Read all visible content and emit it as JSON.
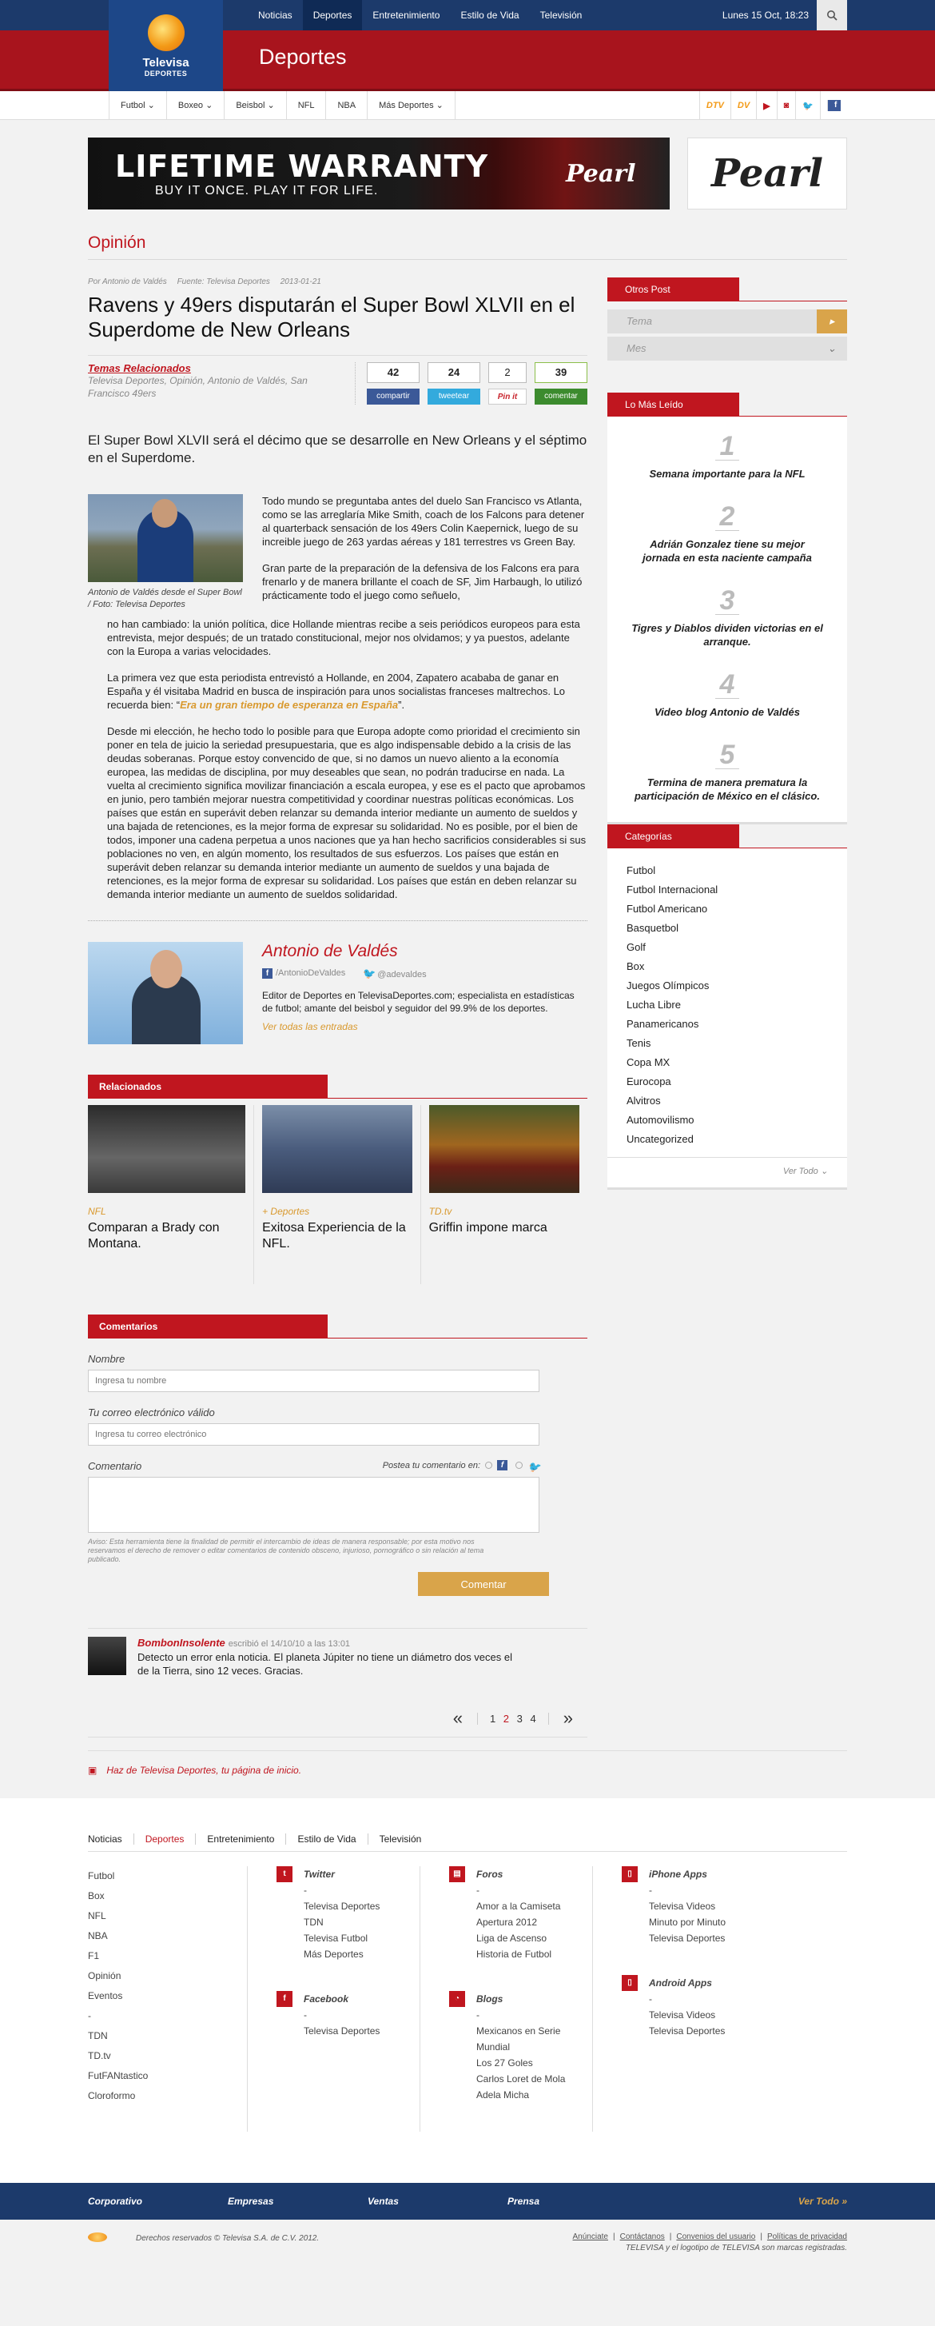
{
  "topnav": {
    "items": [
      "Noticias",
      "Deportes",
      "Entretenimiento",
      "Estilo de Vida",
      "Televisión"
    ],
    "active_index": 1,
    "date": "Lunes 15 Oct, 18:23"
  },
  "logo": {
    "line1": "Televisa",
    "line2": "DEPORTES"
  },
  "section_title": "Deportes",
  "subnav": {
    "items": [
      "Futbol",
      "Boxeo",
      "Beisbol",
      "NFL",
      "NBA",
      "Más Deportes"
    ],
    "icons": [
      "DTV",
      "DV"
    ]
  },
  "ad": {
    "headline": "LIFETIME WARRANTY",
    "tagline": "BUY IT ONCE.   PLAY IT FOR LIFE.",
    "brand": "Pearl",
    "side_brand": "Pearl"
  },
  "section_label": "Opinión",
  "article": {
    "meta": {
      "author": "Por Antonio de Valdés",
      "source": "Fuente: Televisa Deportes",
      "date": "2013-01-21"
    },
    "title": "Ravens y 49ers disputarán el Super Bowl XLVII en el Superdome de New Orleans",
    "related_topics_label": "Temas Relacionados",
    "related_topics": "Televisa Deportes, Opinión, Antonio de Valdés, San Francisco 49ers",
    "share": {
      "facebook": {
        "count": "42",
        "label": "compartir"
      },
      "twitter": {
        "count": "24",
        "label": "tweetear"
      },
      "pinterest": {
        "count": "2",
        "label": "Pin it"
      },
      "comment": {
        "count": "39",
        "label": "comentar"
      }
    },
    "lede": "El Super Bowl XLVII será el décimo que se desarrolle en New Orleans y el séptimo en el Superdome.",
    "figure_caption": "Antonio de Valdés desde el Super Bowl  / Foto: Televisa Deportes",
    "p1": "Todo mundo se preguntaba antes del duelo San Francisco vs Atlanta, como se las arreglaría Mike Smith, coach de los Falcons para detener al quarterback sensación de los 49ers Colin Kaepernick, luego de su increible juego de 263 yardas aéreas y 181 terrestres vs Green Bay.",
    "p2": "Gran parte de la preparación de la defensiva de los Falcons era para frenarlo y de manera brillante el coach de SF, Jim Harbaugh, lo utilizó prácticamente todo el juego como señuelo,",
    "p3": "no han cambiado: la unión política, dice Hollande mientras recibe a seis periódicos europeos para esta entrevista, mejor después; de un tratado constitucional, mejor nos olvidamos; y ya puestos, adelante con la Europa a varias velocidades.",
    "p4_a": "La primera vez que esta periodista entrevistó a Hollande, en 2004, Zapatero acababa de ganar en España y él visitaba Madrid en busca de inspiración para unos socialistas franceses maltrechos. Lo recuerda bien: “",
    "p4_link": "Era un gran tiempo de esperanza en España",
    "p4_b": "”.",
    "p5": "Desde mi elección, he hecho todo lo posible para que Europa adopte como prioridad el crecimiento sin poner en tela de juicio la seriedad presupuestaria, que es algo indispensable debido a la crisis de las deudas soberanas. Porque estoy convencido de que, si no damos un nuevo aliento a la economía europea, las medidas de disciplina, por muy deseables que sean, no podrán traducirse en nada. La vuelta al crecimiento significa movilizar financiación a escala europea, y ese es el pacto que aprobamos en junio, pero también mejorar nuestra competitividad y coordinar nuestras políticas económicas. Los países que están en superávit deben relanzar su demanda interior mediante un aumento de sueldos y una bajada de retenciones, es la mejor forma de expresar su solidaridad. No es posible, por el bien de todos, imponer una cadena perpetua a unos naciones que ya han hecho sacrificios considerables si sus poblaciones no ven, en algún momento, los resultados de sus esfuerzos.  Los países que están en superávit deben relanzar su demanda interior mediante un aumento de sueldos y una bajada de retenciones, es la mejor forma de expresar su solidaridad.  Los países que están en deben relanzar su demanda interior mediante un aumento de sueldos solidaridad."
  },
  "author_box": {
    "name": "Antonio de Valdés",
    "facebook": "/AntonioDeValdes",
    "twitter": "@adevaldes",
    "bio": "Editor de Deportes en TelevisaDeportes.com; especialista en estadísticas de futbol; amante del beisbol y seguidor del 99.9% de los deportes.",
    "all_entries": "Ver todas las entradas"
  },
  "related": {
    "heading": "Relacionados",
    "items": [
      {
        "category": "NFL",
        "title": "Comparan a Brady con Montana."
      },
      {
        "category": "+ Deportes",
        "title": "Exitosa Experiencia de la NFL."
      },
      {
        "category": "TD.tv",
        "title": "Griffin impone marca"
      }
    ]
  },
  "comments": {
    "heading": "Comentarios",
    "name_label": "Nombre",
    "name_placeholder": "Ingresa tu nombre",
    "email_label": "Tu correo electrónico válido",
    "email_placeholder": "Ingresa tu correo electrónico",
    "comment_label": "Comentario",
    "post_on": "Postea tu comentario en:",
    "note": "Aviso: Esta herramienta tiene la finalidad de permitir el intercambio de ideas de manera responsable; por esta motivo nos reservamos el derecho de remover o editar comentarios de contenido obsceno, injurioso, pornográfico o sin relación al tema publicado.",
    "submit": "Comentar",
    "entries": [
      {
        "user": "BombonInsolente",
        "when": "escribió el 14/10/10 a las 13:01",
        "text": "Detecto un error enla noticia. El planeta Júpiter no tiene un diámetro dos veces el de la Tierra, sino 12 veces. Gracias."
      }
    ]
  },
  "pager": {
    "prev": "«",
    "next": "»",
    "pages": [
      "1",
      "2",
      "3",
      "4"
    ],
    "current_index": 1
  },
  "sidebar": {
    "otros_post": {
      "heading": "Otros Post",
      "tema": "Tema",
      "mes": "Mes"
    },
    "mas_leido": {
      "heading": "Lo Más Leído",
      "items": [
        {
          "num": "1",
          "title": "Semana importante para la NFL"
        },
        {
          "num": "2",
          "title": "Adrián Gonzalez tiene su mejor jornada en esta naciente campaña"
        },
        {
          "num": "3",
          "title": "Tigres y Diablos dividen victorias en el arranque."
        },
        {
          "num": "4",
          "title": "Video blog Antonio de Valdés"
        },
        {
          "num": "5",
          "title": "Termina de manera prematura la participación de México en el clásico."
        }
      ]
    },
    "categorias": {
      "heading": "Categorías",
      "items": [
        "Futbol",
        "Futbol Internacional",
        "Futbol Americano",
        "Basquetbol",
        "Golf",
        "Box",
        "Juegos Olímpicos",
        "Lucha Libre",
        "Panamericanos",
        "Tenis",
        "Copa MX",
        "Eurocopa",
        "Alvitros",
        "Automovilismo",
        "Uncategorized"
      ],
      "more": "Ver Todo"
    }
  },
  "homepage_note": "Haz de Televisa Deportes, tu página de inicio.",
  "footer": {
    "nav": [
      "Noticias",
      "Deportes",
      "Entretenimiento",
      "Estilo de Vida",
      "Televisión"
    ],
    "nav_active_index": 1,
    "sections": [
      "Futbol",
      "Box",
      "NFL",
      "NBA",
      "F1",
      "Opinión",
      "Eventos",
      "-",
      "TDN",
      "TD.tv",
      "FutFANtastico",
      "Cloroformo"
    ],
    "twitter": {
      "title": "Twitter",
      "items": [
        "-",
        "Televisa Deportes",
        "TDN",
        "Televisa Futbol",
        "Más Deportes"
      ]
    },
    "facebook": {
      "title": "Facebook",
      "items": [
        "-",
        "Televisa Deportes"
      ]
    },
    "foros": {
      "title": "Foros",
      "items": [
        "-",
        "Amor a la Camiseta",
        "Apertura 2012",
        "Liga de Ascenso",
        "Historia de Futbol"
      ]
    },
    "blogs": {
      "title": "Blogs",
      "items": [
        "-",
        "Mexicanos en Serie Mundial",
        "Los 27 Goles",
        "Carlos Loret de Mola",
        "Adela Micha"
      ]
    },
    "iphone": {
      "title": "iPhone Apps",
      "items": [
        "-",
        "Televisa Videos",
        "Minuto por Minuto",
        "Televisa Deportes"
      ]
    },
    "android": {
      "title": "Android Apps",
      "items": [
        "-",
        "Televisa Videos",
        "Televisa Deportes"
      ]
    },
    "bottom": [
      "Corporativo",
      "Empresas",
      "Ventas",
      "Prensa"
    ],
    "bottom_more": "Ver Todo",
    "rights": "Derechos reservados © Televisa S.A. de C.V. 2012.",
    "links": [
      "Anúnciate",
      "Contáctanos",
      "Convenios del usuario",
      "Políticas de privacidad"
    ],
    "trademark": "TELEVISA y el logotipo de TELEVISA son marcas registradas."
  }
}
